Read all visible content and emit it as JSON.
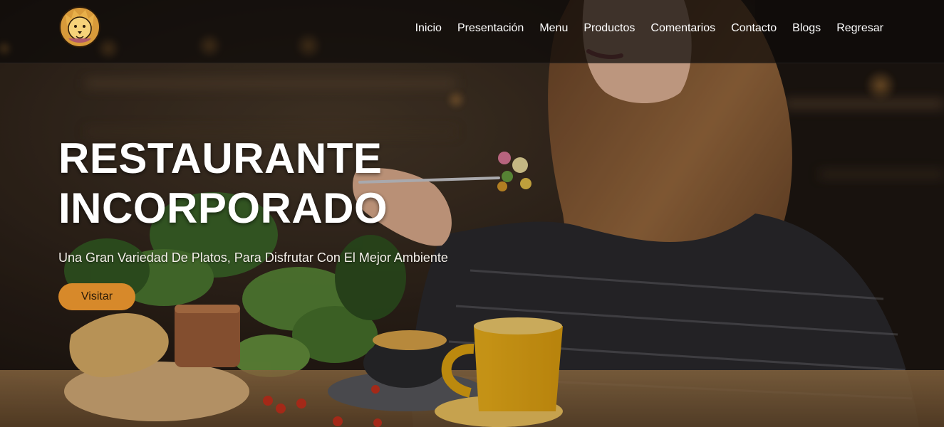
{
  "brand": {
    "logo_icon": "lion-head-icon"
  },
  "nav": {
    "items": [
      {
        "label": "Inicio"
      },
      {
        "label": "Presentación"
      },
      {
        "label": "Menu"
      },
      {
        "label": "Productos"
      },
      {
        "label": "Comentarios"
      },
      {
        "label": "Contacto"
      },
      {
        "label": "Blogs"
      },
      {
        "label": "Regresar"
      }
    ]
  },
  "hero": {
    "title_line1": "RESTAURANTE",
    "title_line2": "INCORPORADO",
    "subtitle": "Una Gran Variedad De Platos, Para Disfrutar Con El Mejor Ambiente",
    "button_label": "Visitar"
  },
  "colors": {
    "accent": "#d7892a",
    "navbar_bg": "#0c0a08",
    "text": "#ffffff"
  }
}
